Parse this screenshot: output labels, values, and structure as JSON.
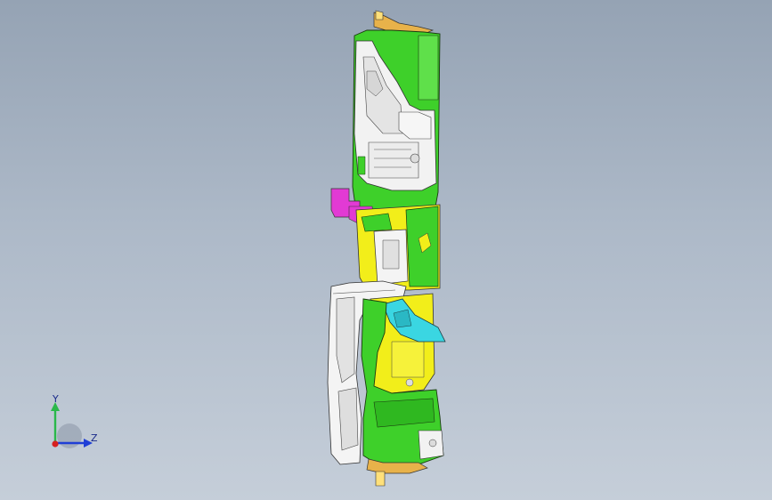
{
  "viewport": {
    "background_top": "#95a3b4",
    "background_bottom": "#c5ced9"
  },
  "model": {
    "colors": {
      "green": "#3ed02a",
      "yellow": "#f2ee1a",
      "magenta": "#e23ad4",
      "cyan": "#3ad6e2",
      "white": "#f4f4f4",
      "orange": "#e8b24a"
    }
  },
  "triad": {
    "y_label": "Y",
    "z_label": "Z",
    "y_color": "#2ab84a",
    "z_color": "#1f3fd6",
    "x_color": "#d62020"
  }
}
